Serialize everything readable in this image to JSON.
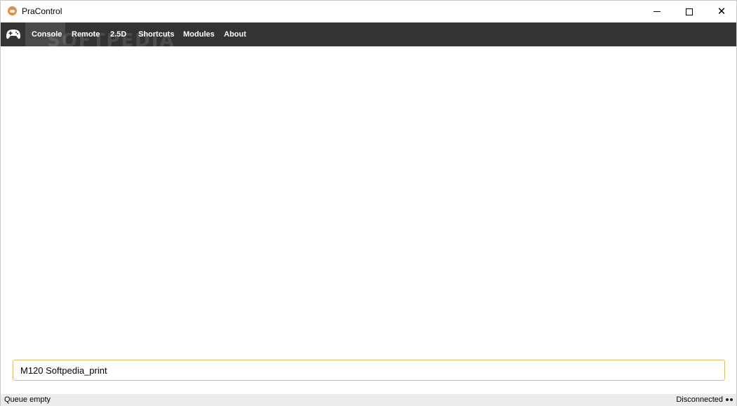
{
  "window": {
    "title": "PraControl",
    "controls": {
      "minimize_icon": "minimize-icon",
      "maximize_icon": "maximize-icon",
      "close_icon": "close-icon",
      "close_glyph": "✕"
    }
  },
  "nav": {
    "logo_icon": "gamepad-icon",
    "items": [
      {
        "label": "Console",
        "active": true
      },
      {
        "label": "Remote",
        "active": false
      },
      {
        "label": "2.5D",
        "active": false
      },
      {
        "label": "Shortcuts",
        "active": false
      },
      {
        "label": "Modules",
        "active": false
      },
      {
        "label": "About",
        "active": false
      }
    ],
    "watermark": "SOFTPEDIA"
  },
  "console": {
    "command_value": "M120 Softpedia_print"
  },
  "status": {
    "left": "Queue empty",
    "right": "Disconnected"
  },
  "colors": {
    "accent": "#e98c3f",
    "nav_bg": "#333333",
    "input_border": "#e8b864",
    "status_bg": "#ececec"
  }
}
